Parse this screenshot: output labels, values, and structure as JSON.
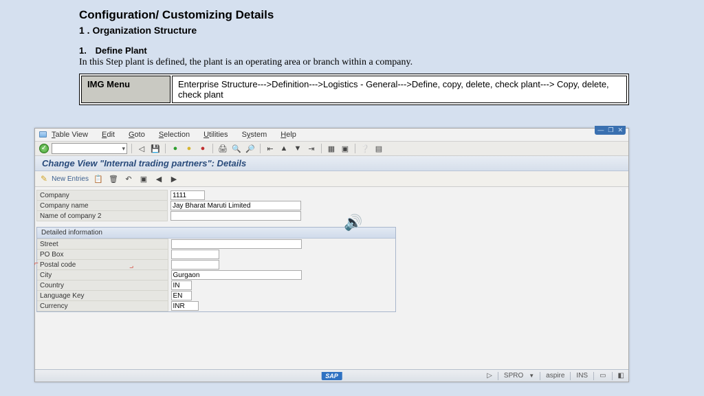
{
  "doc": {
    "title": "Configuration/ Customizing Details",
    "subtitle": "1 . Organization Structure",
    "step_num": "1.",
    "step_title": "Define Plant",
    "step_desc": "In this Step plant is defined, the plant is an operating area or branch within a company.",
    "img_menu_label": "IMG Menu",
    "img_menu_path": "Enterprise Structure--->Definition--->Logistics - General--->Define, copy, delete, check plant---> Copy, delete, check plant"
  },
  "sap": {
    "menu": {
      "table_view": "Table View",
      "edit": "Edit",
      "goto": "Goto",
      "selection": "Selection",
      "utilities": "Utilities",
      "system": "System",
      "help": "Help"
    },
    "view_title": "Change View \"Internal trading partners\": Details",
    "app_toolbar": {
      "new_entries": "New Entries"
    },
    "form": {
      "company_lbl": "Company",
      "company_val": "1111",
      "company_name_lbl": "Company name",
      "company_name_val": "Jay Bharat Maruti Limited",
      "name2_lbl": "Name of company 2",
      "name2_val": ""
    },
    "detail_header": "Detailed information",
    "detail": {
      "street_lbl": "Street",
      "street_val": "",
      "pobox_lbl": "PO Box",
      "pobox_val": "",
      "postal_lbl": "Postal code",
      "postal_val": "",
      "city_lbl": "City",
      "city_val": "Gurgaon",
      "country_lbl": "Country",
      "country_val": "IN",
      "lang_lbl": "Language Key",
      "lang_val": "EN",
      "curr_lbl": "Currency",
      "curr_val": "INR"
    },
    "status": {
      "logo": "SAP",
      "tcode": "SPRO",
      "client": "aspire",
      "mode": "INS",
      "play": "▷"
    },
    "win_controls": {
      "min": "—",
      "max": "❐",
      "close": "✕"
    }
  }
}
